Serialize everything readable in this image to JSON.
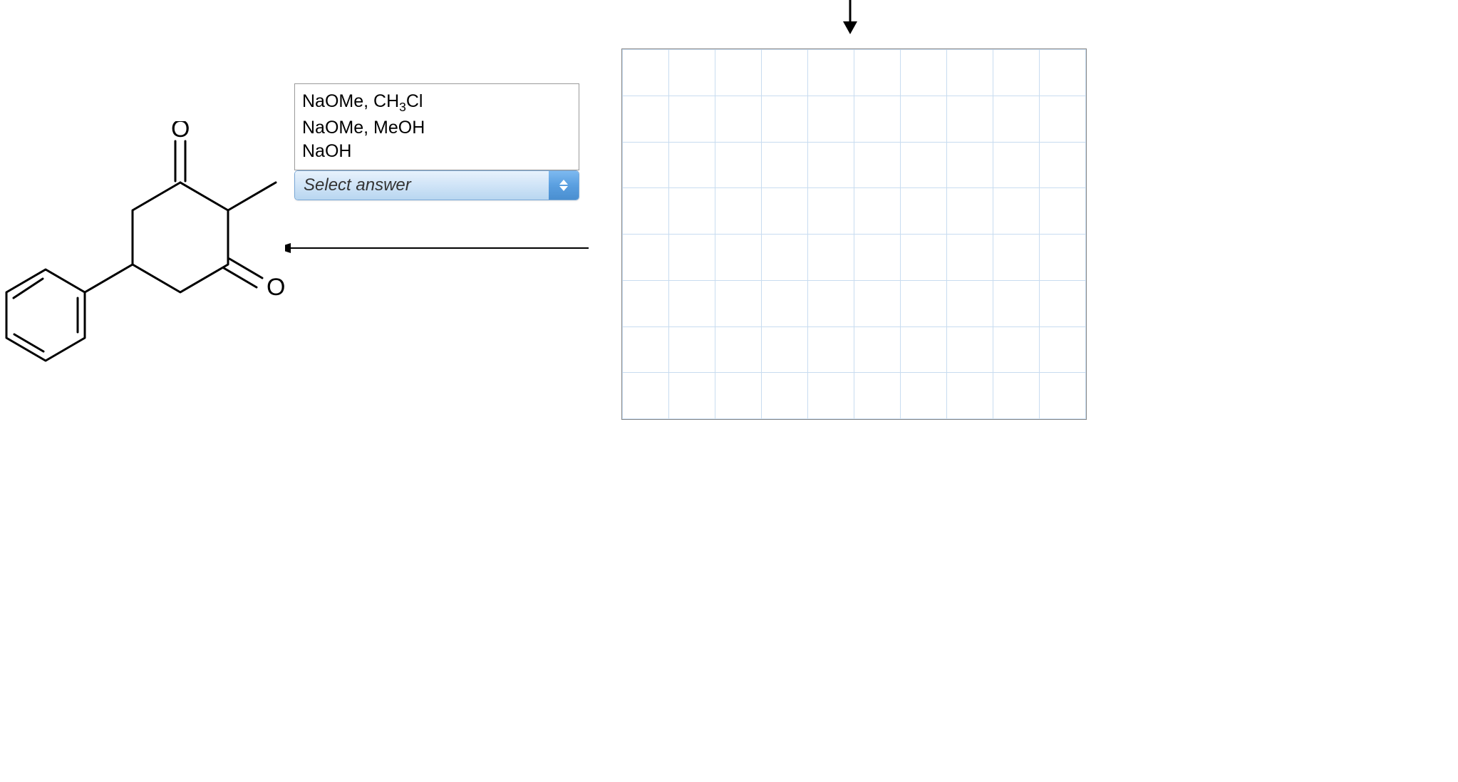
{
  "dropdown": {
    "options": {
      "option1_pre": "NaOMe, CH",
      "option1_sub": "3",
      "option1_post": "Cl",
      "option2": "NaOMe, MeOH",
      "option3": "NaOH"
    },
    "placeholder": "Select answer"
  },
  "molecule": {
    "atom_O1": "O",
    "atom_O2": "O"
  },
  "grid": {
    "rows": 8,
    "cols": 10
  }
}
